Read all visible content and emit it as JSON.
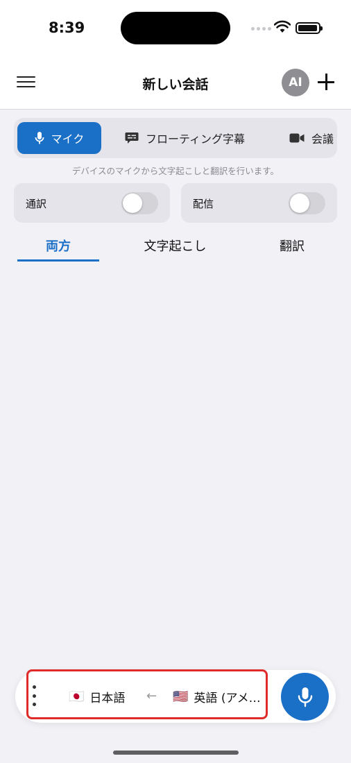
{
  "status_bar": {
    "time": "8:39"
  },
  "nav": {
    "title": "新しい会話",
    "avatar_label": "AI"
  },
  "modes": {
    "mic": "マイク",
    "floating": "フローティング字幕",
    "meeting": "会議",
    "hint": "デバイスのマイクから文字起こしと翻訳を行います。"
  },
  "toggles": {
    "interpret": {
      "label": "通訳",
      "on": false
    },
    "broadcast": {
      "label": "配信",
      "on": false
    }
  },
  "tabs": {
    "both": "両方",
    "transcribe": "文字起こし",
    "translate": "翻訳",
    "active": "both"
  },
  "languages": {
    "source": {
      "flag": "🇯🇵",
      "name": "日本語"
    },
    "target": {
      "flag": "🇺🇸",
      "name": "英語 (アメ…"
    },
    "arrow": "←"
  },
  "colors": {
    "accent": "#1a6fc6",
    "highlight": "#e02b2b"
  }
}
